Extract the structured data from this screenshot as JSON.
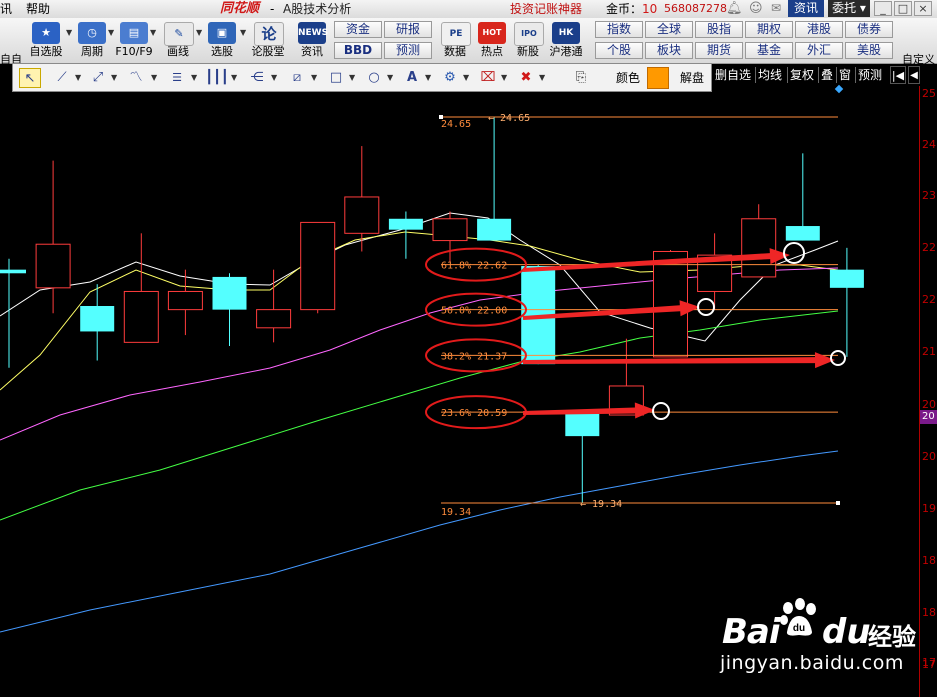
{
  "menu": {
    "left_label": "讯",
    "help": "帮助",
    "brand": "同花顺",
    "brand_suffix": "-",
    "subtitle": "A股技术分析",
    "promo": "投资记账神器",
    "coin_label": "金币：",
    "coin_value": "10",
    "account": "568087278",
    "zixun": "资讯",
    "weituo": "委托 ▾",
    "minimize": "_",
    "maximize": "□",
    "close": "×"
  },
  "toolbar": {
    "left_edge": "自自",
    "buttons": [
      {
        "label": "自选股",
        "icon_text": "★"
      },
      {
        "label": "周期",
        "icon_text": "◷"
      },
      {
        "label": "F10/F9",
        "icon_text": "▤"
      },
      {
        "label": "画线",
        "icon_text": "✎"
      },
      {
        "label": "选股",
        "icon_text": "▣"
      },
      {
        "label": "论股堂",
        "icon_text": "论"
      },
      {
        "label": "资讯",
        "icon_text": "NEWS"
      }
    ],
    "mid_buttons_top": [
      "资金",
      "研报"
    ],
    "mid_buttons_bottom": [
      "BBD",
      "预测"
    ],
    "icon_buttons": [
      {
        "label": "数据",
        "icon_text": "PE"
      },
      {
        "label": "热点",
        "icon_text": "HOT"
      },
      {
        "label": "新股",
        "icon_text": "IPO"
      },
      {
        "label": "沪港通",
        "icon_text": "HK"
      }
    ],
    "market_top": [
      "指数",
      "全球",
      "股指",
      "期权",
      "港股",
      "债券"
    ],
    "market_bottom": [
      "个股",
      "板块",
      "期货",
      "基金",
      "外汇",
      "美股"
    ],
    "custom": "自定义"
  },
  "drawbar": {
    "tools": [
      "pointer-tool",
      "line-tool",
      "ray-tool",
      "wave-tool",
      "text-mark-tool",
      "period-lines-tool",
      "fan-tool",
      "channel-tool",
      "rectangle-tool",
      "ellipse-tool",
      "text-tool",
      "settings-tool",
      "delete-bookmark-tool",
      "delete-tool",
      "export-tool"
    ],
    "color_label": "颜色",
    "color_value": "#ff9900",
    "unlock_label": "解盘"
  },
  "tabs": [
    "删自选",
    "均线",
    "复权",
    "叠",
    "窗",
    "预测"
  ],
  "price_axis": [
    "25",
    "24",
    "23",
    "22",
    "22",
    "21",
    "20",
    "20",
    "19",
    "18",
    "18",
    "17",
    "17"
  ],
  "axis_marker": "20",
  "chart_data": {
    "type": "candlestick",
    "title": "",
    "fibonacci": {
      "high": "24.65",
      "low": "19.34",
      "high_label": "24.65",
      "low_label": "19.34",
      "levels": [
        {
          "ratio": "61.8%",
          "price": "22.62"
        },
        {
          "ratio": "50.0%",
          "price": "22.00"
        },
        {
          "ratio": "38.2%",
          "price": "21.37"
        },
        {
          "ratio": "23.6%",
          "price": "20.59"
        }
      ],
      "top_marker": "24.65",
      "bottom_marker": "19.34"
    },
    "candles": [
      {
        "o": 22.5,
        "c": 22.55,
        "h": 22.7,
        "l": 21.2,
        "color": "cyan"
      },
      {
        "o": 22.3,
        "c": 22.9,
        "h": 24.05,
        "l": 21.95,
        "color": "red"
      },
      {
        "o": 22.05,
        "c": 21.7,
        "h": 22.35,
        "l": 21.3,
        "color": "cyan"
      },
      {
        "o": 21.55,
        "c": 22.25,
        "h": 23.05,
        "l": 21.55,
        "color": "red"
      },
      {
        "o": 22.0,
        "c": 22.25,
        "h": 22.55,
        "l": 21.65,
        "color": "red"
      },
      {
        "o": 22.0,
        "c": 22.45,
        "h": 22.5,
        "l": 21.5,
        "color": "cyan"
      },
      {
        "o": 21.75,
        "c": 22.0,
        "h": 22.55,
        "l": 21.55,
        "color": "red"
      },
      {
        "o": 22.0,
        "c": 23.2,
        "h": 23.2,
        "l": 21.95,
        "color": "red"
      },
      {
        "o": 23.05,
        "c": 23.55,
        "h": 24.25,
        "l": 22.8,
        "color": "red"
      },
      {
        "o": 23.1,
        "c": 23.25,
        "h": 23.35,
        "l": 22.7,
        "color": "cyan"
      },
      {
        "o": 22.95,
        "c": 23.25,
        "h": 23.35,
        "l": 22.65,
        "color": "red"
      },
      {
        "o": 23.25,
        "c": 22.95,
        "h": 24.65,
        "l": 22.95,
        "color": "cyan"
      },
      {
        "o": 22.6,
        "c": 21.25,
        "h": 22.62,
        "l": 21.25,
        "color": "cyan"
      },
      {
        "o": 20.58,
        "c": 20.26,
        "h": 20.58,
        "l": 19.34,
        "color": "cyan"
      },
      {
        "o": 20.55,
        "c": 20.95,
        "h": 21.6,
        "l": 20.55,
        "color": "red"
      },
      {
        "o": 21.35,
        "c": 22.8,
        "h": 22.82,
        "l": 21.35,
        "color": "red"
      },
      {
        "o": 22.25,
        "c": 22.75,
        "h": 23.05,
        "l": 22.0,
        "color": "red"
      },
      {
        "o": 22.45,
        "c": 23.25,
        "h": 23.45,
        "l": 22.45,
        "color": "red"
      },
      {
        "o": 23.15,
        "c": 22.95,
        "h": 24.15,
        "l": 22.95,
        "color": "cyan"
      },
      {
        "o": 22.55,
        "c": 22.3,
        "h": 22.85,
        "l": 21.35,
        "color": "cyan"
      }
    ],
    "ma_lines": [
      {
        "name": "MA5",
        "color": "#ffffff"
      },
      {
        "name": "MA10",
        "color": "#ffff66"
      },
      {
        "name": "MA20",
        "color": "#ff66ff"
      },
      {
        "name": "MA30",
        "color": "#44ff44"
      },
      {
        "name": "MA60",
        "color": "#4499ff"
      }
    ],
    "annotations": {
      "circles": 4,
      "arrows": 4,
      "ellipses": 4
    },
    "ylim": [
      16.6,
      25.2
    ]
  },
  "watermark": {
    "bai": "Bai",
    "du": "du",
    "jingyan": "经验",
    "url": "jingyan.baidu.com"
  }
}
